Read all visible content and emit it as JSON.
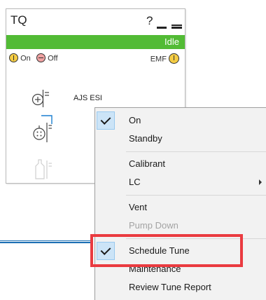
{
  "panel": {
    "title": "TQ",
    "help": "?",
    "status": "Idle",
    "status_color": "#52bb35",
    "legend": {
      "on": "On",
      "off": "Off",
      "emf": "EMF"
    },
    "source_label": "AJS ESI"
  },
  "menu": {
    "items": [
      {
        "label": "On",
        "checked": true,
        "enabled": true
      },
      {
        "label": "Standby",
        "checked": false,
        "enabled": true
      },
      {
        "label": "Calibrant",
        "checked": false,
        "enabled": true
      },
      {
        "label": "LC",
        "checked": false,
        "enabled": true,
        "submenu": true
      },
      {
        "label": "Vent",
        "checked": false,
        "enabled": true
      },
      {
        "label": "Pump Down",
        "checked": false,
        "enabled": false
      },
      {
        "label": "Schedule Tune",
        "checked": true,
        "enabled": true
      },
      {
        "label": "Maintenance",
        "checked": false,
        "enabled": true
      },
      {
        "label": "Review Tune Report",
        "checked": false,
        "enabled": true
      }
    ],
    "highlight_color": "#ea3b40"
  }
}
